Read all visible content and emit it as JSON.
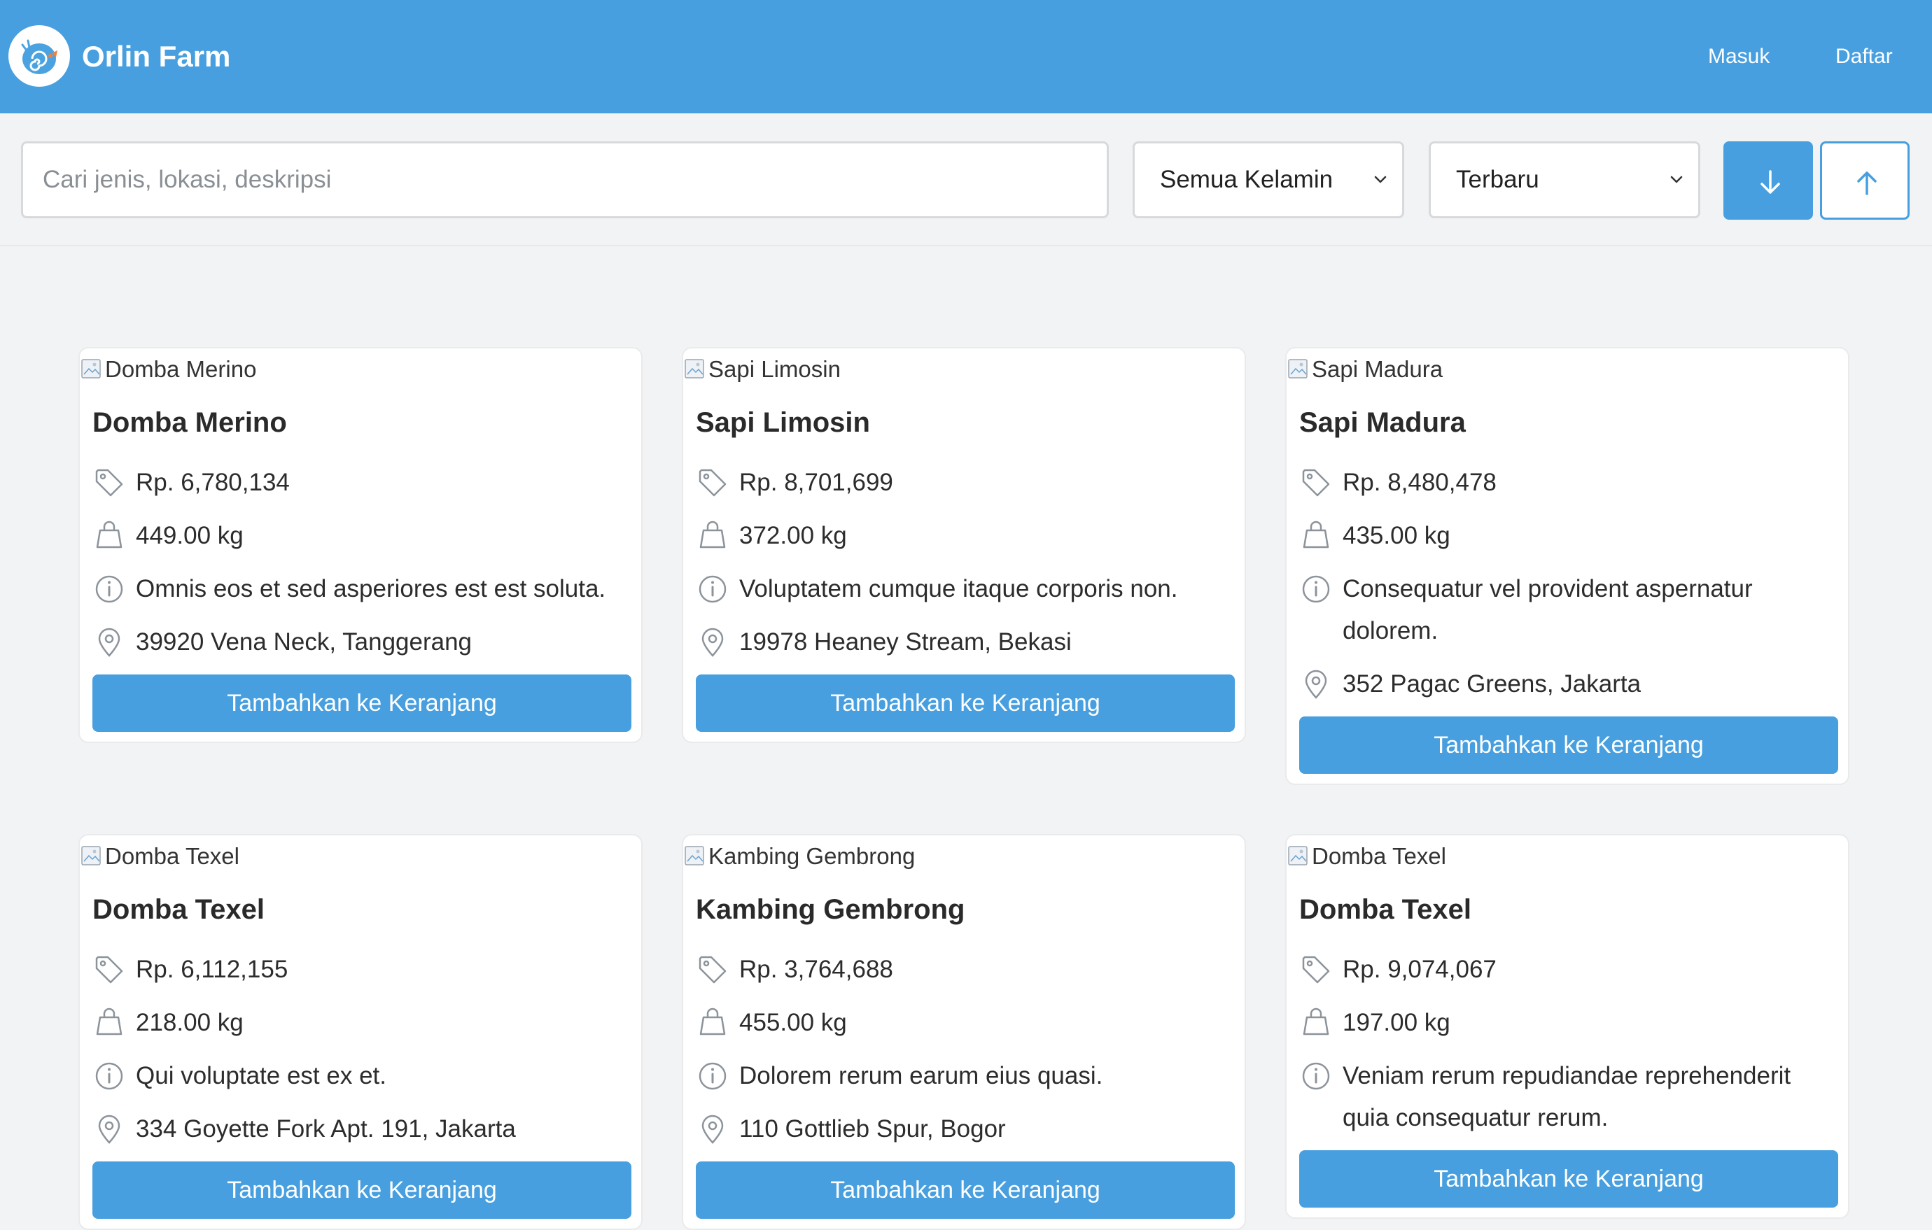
{
  "header": {
    "brand": "Orlin Farm",
    "nav": {
      "login": "Masuk",
      "register": "Daftar"
    },
    "color": "#479fdf"
  },
  "filters": {
    "search_placeholder": "Cari jenis, lokasi, deskripsi",
    "search_value": "",
    "gender_selected": "Semua Kelamin",
    "sort_selected": "Terbaru",
    "sort_desc_icon": "arrow-down-icon",
    "sort_asc_icon": "arrow-up-icon"
  },
  "products": [
    {
      "image_alt": "Domba Merino",
      "name": "Domba Merino",
      "price": "Rp. 6,780,134",
      "weight": "449.00 kg",
      "description": "Omnis eos et sed asperiores est est soluta.",
      "location": "39920 Vena Neck, Tanggerang",
      "button": "Tambahkan ke Keranjang"
    },
    {
      "image_alt": "Sapi Limosin",
      "name": "Sapi Limosin",
      "price": "Rp. 8,701,699",
      "weight": "372.00 kg",
      "description": "Voluptatem cumque itaque corporis non.",
      "location": "19978 Heaney Stream, Bekasi",
      "button": "Tambahkan ke Keranjang"
    },
    {
      "image_alt": "Sapi Madura",
      "name": "Sapi Madura",
      "price": "Rp. 8,480,478",
      "weight": "435.00 kg",
      "description": "Consequatur vel provident aspernatur dolorem.",
      "location": "352 Pagac Greens, Jakarta",
      "button": "Tambahkan ke Keranjang"
    },
    {
      "image_alt": "Domba Texel",
      "name": "Domba Texel",
      "price": "Rp. 6,112,155",
      "weight": "218.00 kg",
      "description": "Qui voluptate est ex et.",
      "location": "334 Goyette Fork Apt. 191, Jakarta",
      "button": "Tambahkan ke Keranjang"
    },
    {
      "image_alt": "Kambing Gembrong",
      "name": "Kambing Gembrong",
      "price": "Rp. 3,764,688",
      "weight": "455.00 kg",
      "description": "Dolorem rerum earum eius quasi.",
      "location": "110 Gottlieb Spur, Bogor",
      "button": "Tambahkan ke Keranjang"
    },
    {
      "image_alt": "Domba Texel",
      "name": "Domba Texel",
      "price": "Rp. 9,074,067",
      "weight": "197.00 kg",
      "description": "Veniam rerum repudiandae reprehenderit quia consequatur rerum.",
      "location": "",
      "button": "Tambahkan ke Keranjang"
    }
  ]
}
